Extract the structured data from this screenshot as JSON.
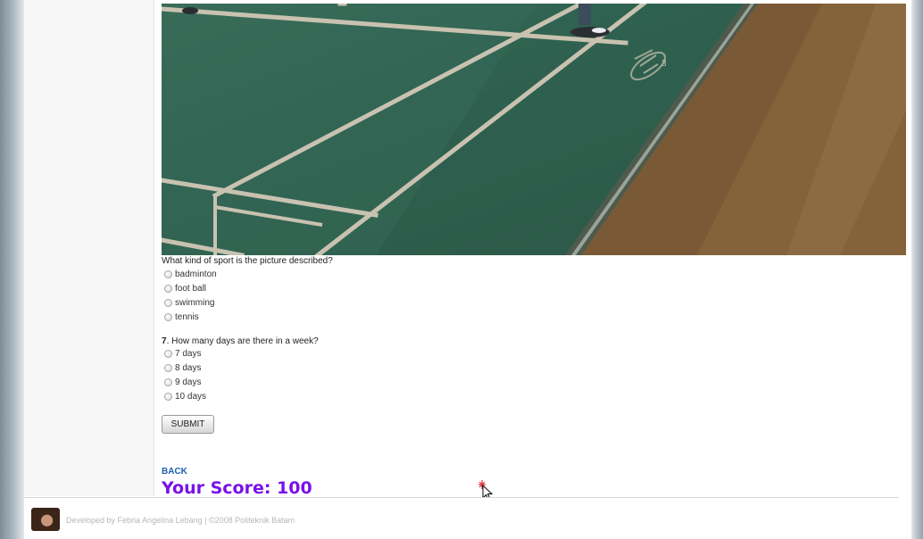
{
  "quiz": {
    "question6": {
      "text": "What kind of sport is the picture described?",
      "options": [
        "badminton",
        "foot ball",
        "swimming",
        "tennis"
      ]
    },
    "question7": {
      "number": "7",
      "text": ". How many days are there in a week?",
      "options": [
        "7 days",
        "8 days",
        "9 days",
        "10 days"
      ]
    },
    "submit_label": "SUBMIT"
  },
  "back_label": "BACK",
  "score_text": "Your Score: 100",
  "footer": {
    "credit": "Developed by Febria Angelina Lebang | ©2008 Politeknik Batam"
  },
  "colors": {
    "score": "#7a10e8",
    "back_link": "#1f5fb0",
    "court_green": "#2f6150",
    "court_wood": "#7a5a36"
  }
}
